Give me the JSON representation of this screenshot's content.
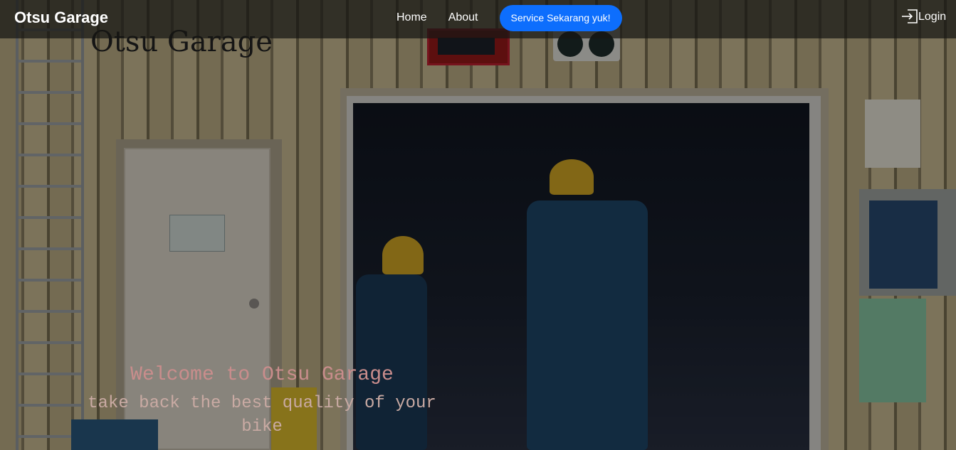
{
  "navbar": {
    "brand": "Otsu Garage",
    "links": [
      {
        "label": "Home"
      },
      {
        "label": "About"
      }
    ],
    "cta_label": "Service Sekarang yuk!",
    "login_label": "Login",
    "login_icon": "box-arrow-in-right-icon"
  },
  "hero": {
    "title": "Otsu Garage",
    "welcome": "Welcome to Otsu Garage",
    "tagline": "take back the best quality of your bike"
  },
  "colors": {
    "navbar_bg": "rgba(22,22,20,0.72)",
    "cta_bg": "#0d6efd",
    "welcome_text": "#c98d8c",
    "tagline_text": "#c9aaa3"
  }
}
